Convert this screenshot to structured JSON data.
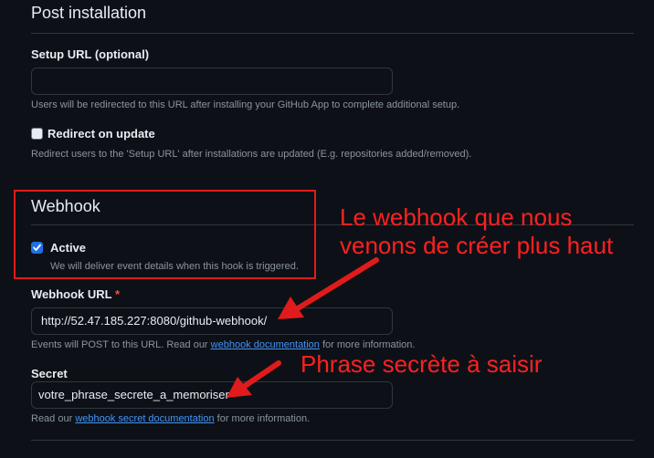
{
  "post_installation": {
    "title": "Post installation",
    "setup_url_label": "Setup URL (optional)",
    "setup_url_value": "",
    "setup_url_help": "Users will be redirected to this URL after installing your GitHub App to complete additional setup.",
    "redirect_label": "Redirect on update",
    "redirect_checked": false,
    "redirect_help": "Redirect users to the 'Setup URL' after installations are updated (E.g. repositories added/removed)."
  },
  "webhook": {
    "title": "Webhook",
    "active_label": "Active",
    "active_checked": true,
    "active_help": "We will deliver event details when this hook is triggered.",
    "url_label": "Webhook URL",
    "required_mark": "*",
    "url_value": "http://52.47.185.227:8080/github-webhook/",
    "url_help_prefix": "Events will POST to this URL. Read our",
    "url_help_link": "webhook documentation",
    "url_help_suffix": "for more information.",
    "secret_label": "Secret",
    "secret_value": "votre_phrase_secrete_a_memoriser",
    "secret_help_prefix": "Read our",
    "secret_help_link": "webhook secret documentation",
    "secret_help_suffix": "for more information."
  },
  "annotations": {
    "webhook_note_line1": "Le webhook que nous",
    "webhook_note_line2": "venons de créer plus haut",
    "secret_note": "Phrase secrète à saisir",
    "color": "#ff2020"
  },
  "colors": {
    "background": "#0d1117",
    "border": "#30363d",
    "link": "#4493f8",
    "checkbox_active": "#1f6feb",
    "required": "#f85149"
  }
}
